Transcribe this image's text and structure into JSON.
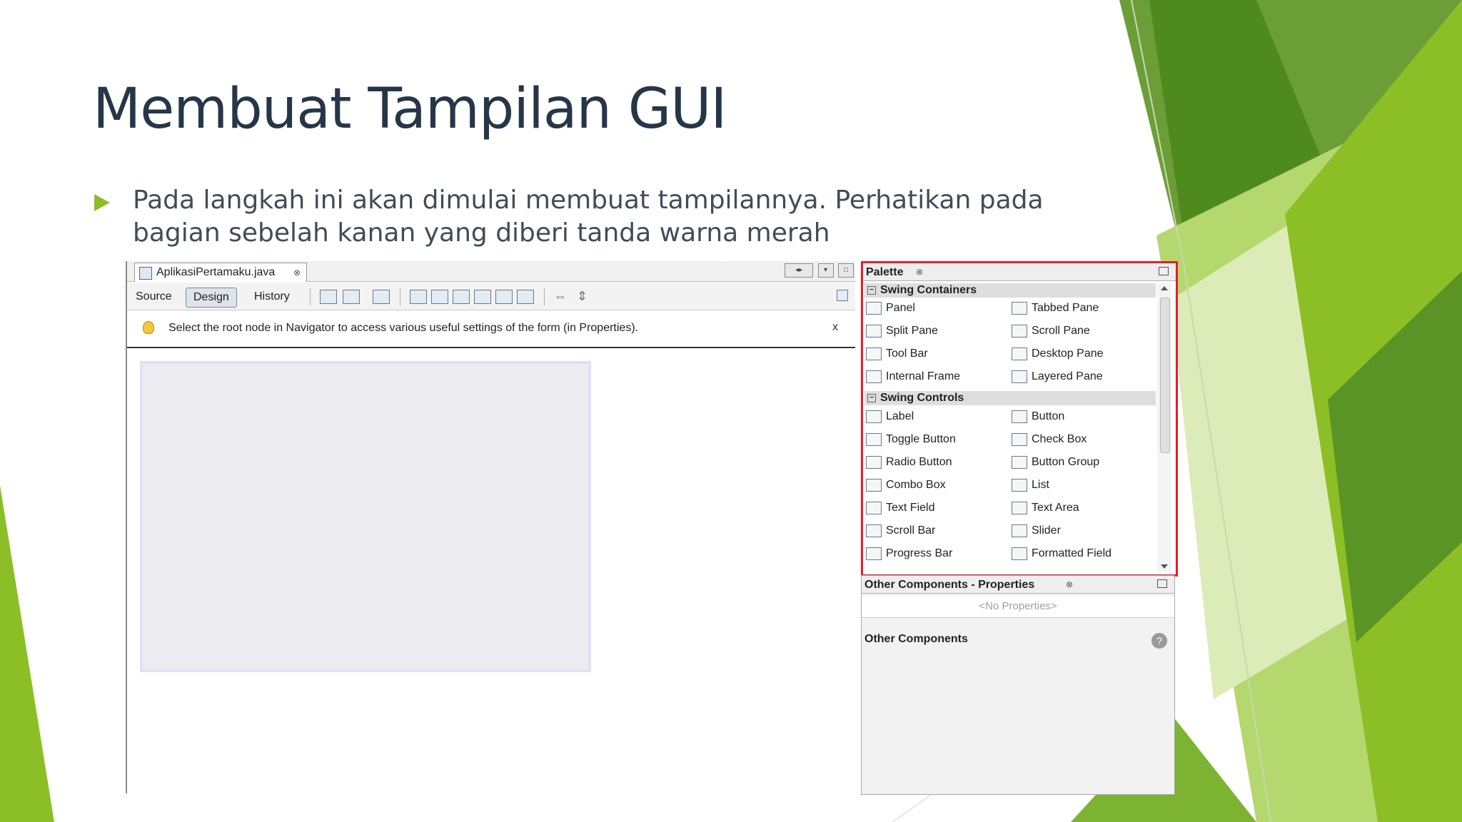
{
  "slide": {
    "title": "Membuat Tampilan GUI",
    "bullet": "Pada langkah ini akan dimulai membuat tampilannya. Perhatikan pada bagian sebelah kanan yang diberi tanda warna merah"
  },
  "colors": {
    "title": "#263648",
    "bullet_arrow": "#8cbf26",
    "highlight_border": "#e81c24",
    "green_dark": "#4f8a1e",
    "green_light": "#b5d86e"
  },
  "editor": {
    "file_tab": "AplikasiPertamaku.java",
    "file_tab_close": "⊗",
    "modes": [
      "Source",
      "Design",
      "History"
    ],
    "active_mode": "Design",
    "hint": "Select the root node in Navigator to access various useful settings of the form (in Properties).",
    "hint_close": "x",
    "tab_controls": [
      "◂▸",
      "▾",
      "□"
    ]
  },
  "palette": {
    "title": "Palette",
    "close": "⊗",
    "categories": [
      {
        "name": "Swing Containers",
        "items": [
          "Panel",
          "Tabbed Pane",
          "Split Pane",
          "Scroll Pane",
          "Tool Bar",
          "Desktop Pane",
          "Internal Frame",
          "Layered Pane"
        ]
      },
      {
        "name": "Swing Controls",
        "items": [
          "Label",
          "Button",
          "Toggle Button",
          "Check Box",
          "Radio Button",
          "Button Group",
          "Combo Box",
          "List",
          "Text Field",
          "Text Area",
          "Scroll Bar",
          "Slider",
          "Progress Bar",
          "Formatted Field"
        ]
      }
    ]
  },
  "properties": {
    "title": "Other Components - Properties",
    "close": "⊗",
    "empty": "<No Properties>",
    "section": "Other Components",
    "help": "?"
  }
}
